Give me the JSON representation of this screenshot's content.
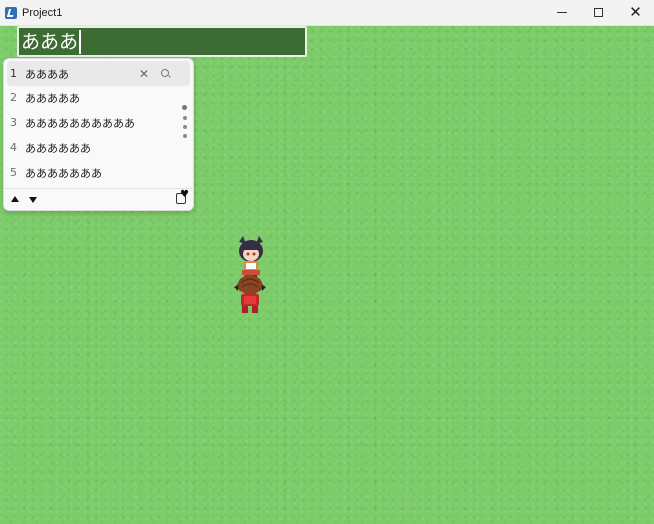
{
  "window": {
    "title": "Project1",
    "controls": {
      "minimize": "minimize",
      "maximize": "maximize",
      "close": "✕"
    }
  },
  "name_input": {
    "value": "あああ"
  },
  "ime": {
    "candidates": [
      {
        "num": "1",
        "text": "ああああ"
      },
      {
        "num": "2",
        "text": "あああああ"
      },
      {
        "num": "3",
        "text": "ああああああああああ"
      },
      {
        "num": "4",
        "text": "ああああああ"
      },
      {
        "num": "5",
        "text": "あああああああ"
      }
    ],
    "selected_index": 0,
    "icons": [
      "close-icon",
      "search-icon",
      "arrow-up-icon",
      "arrow-down-icon",
      "favorite-icon"
    ],
    "close_glyph": "✕"
  },
  "colors": {
    "grass": "#7ccc6a",
    "input_bg": "#3d6b34",
    "popup_bg": "#f9f9f9"
  }
}
